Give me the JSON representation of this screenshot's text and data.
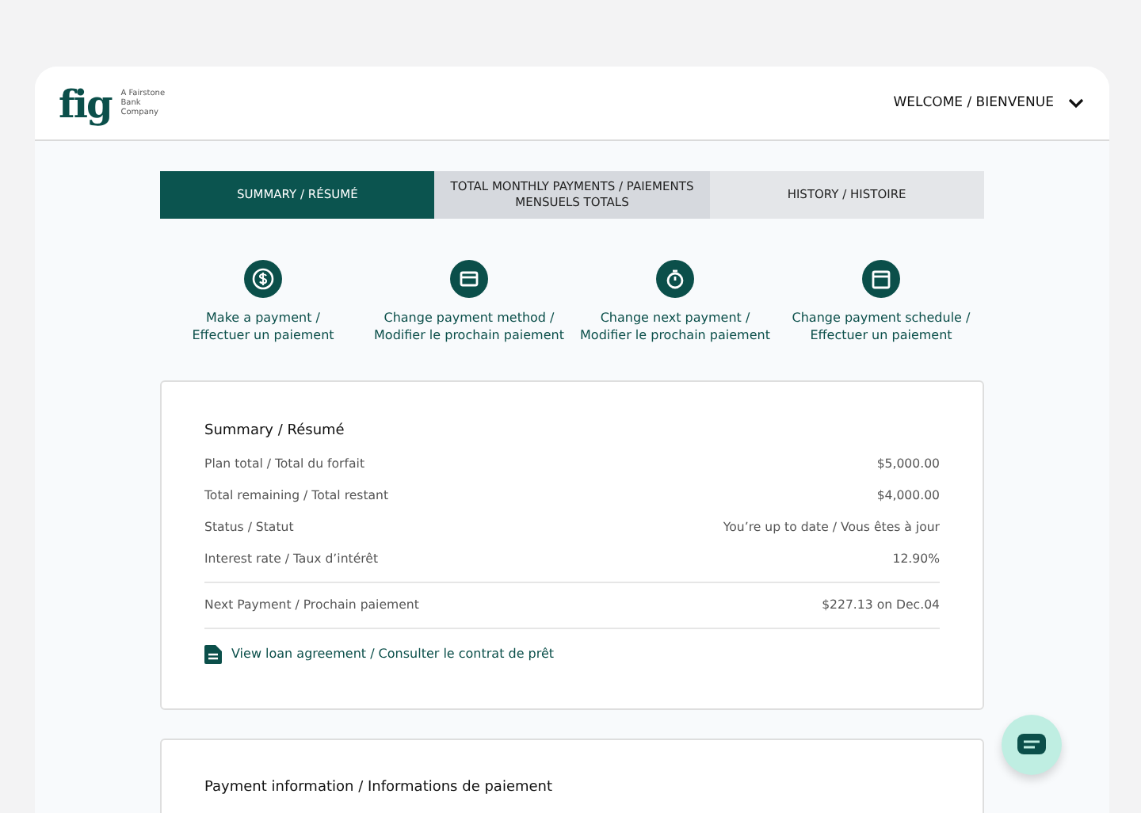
{
  "header": {
    "logo": "fig",
    "tagline": "A Fairstone Bank Company",
    "welcome": "WELCOME / BIENVENUE"
  },
  "tabs": [
    {
      "label": "SUMMARY / RÉSUMÉ",
      "selected": true
    },
    {
      "label": "TOTAL MONTHLY PAYMENTS / PAIEMENTS MENSUELS TOTALS",
      "selected": false
    },
    {
      "label": "HISTORY / HISTOIRE",
      "selected": false
    }
  ],
  "actions": [
    {
      "kind": "dollar",
      "label_lines": [
        "Make a payment /",
        "Effectuer un paiement"
      ]
    },
    {
      "kind": "card",
      "label_lines": [
        "Change payment method /",
        "Modifier le prochain paiement"
      ]
    },
    {
      "kind": "timer",
      "label_lines": [
        "Change next payment /",
        "Modifier le prochain paiement"
      ]
    },
    {
      "kind": "calendar",
      "label_lines": [
        "Change payment schedule /",
        "Effectuer un paiement"
      ]
    }
  ],
  "summary": {
    "title": "Summary / Résumé",
    "rows": [
      {
        "label": "Plan total / Total du forfait",
        "value": "$5,000.00"
      },
      {
        "label": "Total remaining / Total restant",
        "value": "$4,000.00"
      },
      {
        "label": "Status / Statut",
        "value": "You’re up to date / Vous êtes à jour"
      },
      {
        "label": "Interest rate / Taux d’intérêt",
        "value": "12.90%"
      }
    ],
    "next_payment": {
      "label": "Next Payment  / Prochain paiement",
      "value": "$227.13 on Dec.04"
    },
    "link": "View loan agreement / Consulter le contrat de prêt"
  },
  "payment_info": {
    "title": "Payment information / Informations de paiement"
  }
}
